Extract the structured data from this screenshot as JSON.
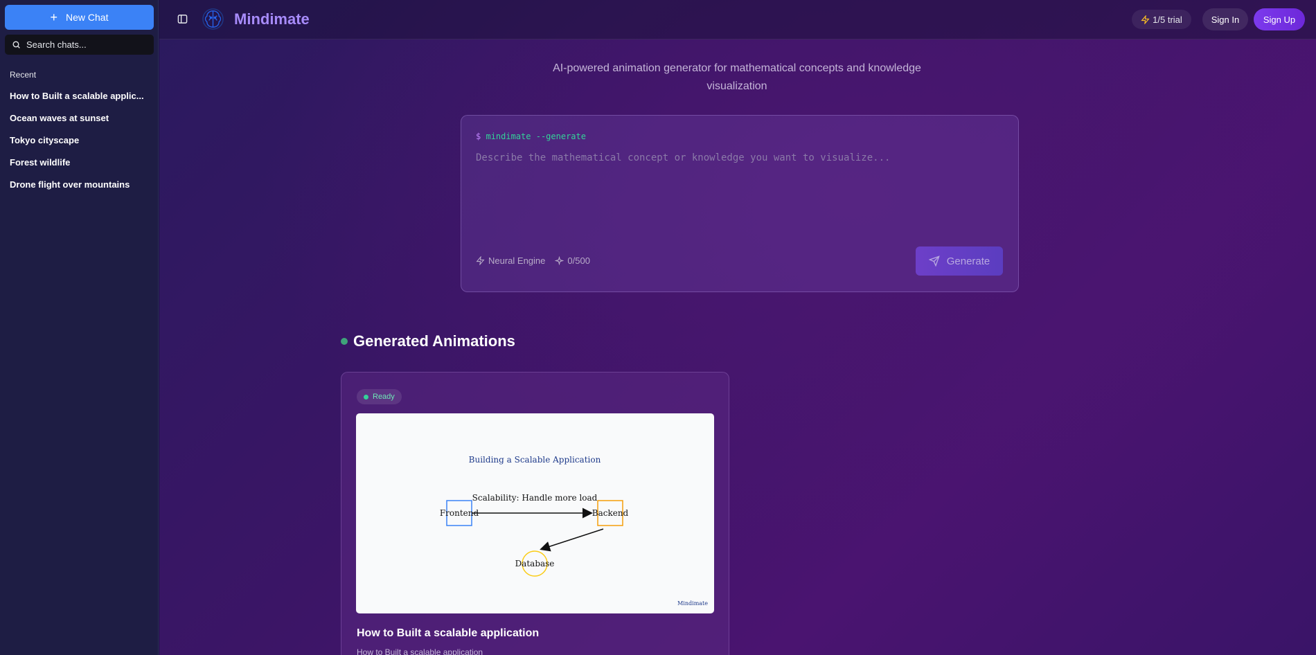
{
  "sidebar": {
    "new_chat_label": "New Chat",
    "search_placeholder": "Search chats...",
    "recent_label": "Recent",
    "items": [
      {
        "label": "How to Built a scalable applic..."
      },
      {
        "label": "Ocean waves at sunset"
      },
      {
        "label": "Tokyo cityscape"
      },
      {
        "label": "Forest wildlife"
      },
      {
        "label": "Drone flight over mountains"
      }
    ]
  },
  "header": {
    "brand": "Mindimate",
    "trial": "1/5 trial",
    "sign_in": "Sign In",
    "sign_up": "Sign Up"
  },
  "hero": {
    "subtitle_line1": "AI-powered animation generator for mathematical concepts and knowledge",
    "subtitle_line2": "visualization"
  },
  "prompt": {
    "cmd_prefix": "$",
    "cmd_text": "mindimate --generate",
    "placeholder": "Describe the mathematical concept or knowledge you want to visualize...",
    "value": "",
    "engine": "Neural Engine",
    "char_count": "0/500",
    "generate_label": "Generate"
  },
  "gallery": {
    "section_title": "Generated Animations",
    "cards": [
      {
        "status": "Ready",
        "title": "How to Built a scalable application",
        "description": "How to Built a scalable application",
        "preview": {
          "heading": "Building a Scalable Application",
          "caption": "Scalability: Handle more load",
          "node_frontend": "Frontend",
          "node_backend": "Backend",
          "node_database": "Database",
          "watermark": "Mindimate"
        }
      }
    ]
  },
  "colors": {
    "accent": "#3b82f6",
    "brand": "#a78bfa",
    "ready": "#34d399",
    "signup": "#7c3aed"
  }
}
